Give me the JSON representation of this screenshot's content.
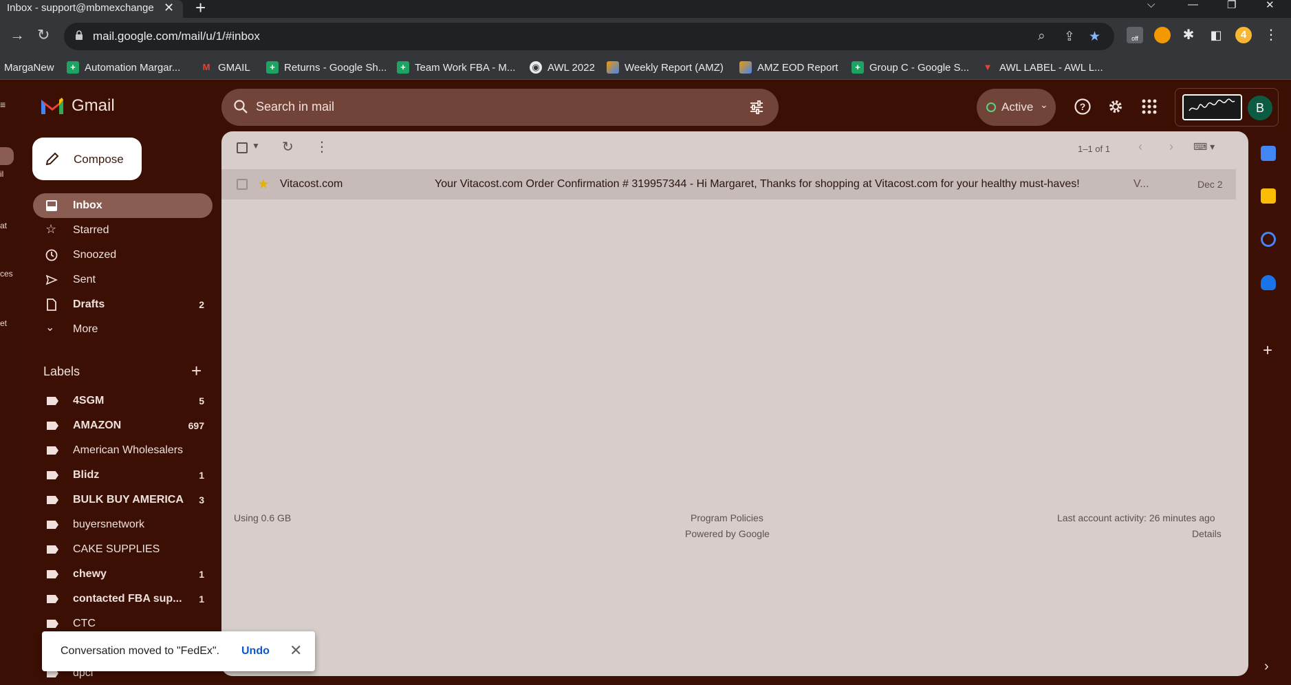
{
  "browser": {
    "tab_title": "Inbox - support@mbmexchange",
    "url": "mail.google.com/mail/u/1/#inbox",
    "extension_off_label": "off",
    "profile_badge": "4",
    "bookmarks": [
      {
        "label": "MargaNew",
        "icon": "none"
      },
      {
        "label": "Automation Margar...",
        "icon": "sheets-icon"
      },
      {
        "label": "GMAIL",
        "icon": "gmail-icon"
      },
      {
        "label": "Returns - Google Sh...",
        "icon": "sheets-icon"
      },
      {
        "label": "Team Work FBA - M...",
        "icon": "sheets-icon"
      },
      {
        "label": "AWL 2022",
        "icon": "globe-icon"
      },
      {
        "label": "Weekly Report (AMZ)",
        "icon": "report-icon"
      },
      {
        "label": "AMZ EOD Report",
        "icon": "report-icon"
      },
      {
        "label": "Group C - Google S...",
        "icon": "sheets-icon"
      },
      {
        "label": "AWL LABEL - AWL L...",
        "icon": "awl-icon"
      }
    ]
  },
  "gmail": {
    "brand": "Gmail",
    "search_placeholder": "Search in mail",
    "status_label": "Active",
    "avatar_initial": "B",
    "left_strip_labels": [
      "il",
      "at",
      "ces",
      "et"
    ],
    "compose_label": "Compose",
    "nav": [
      {
        "label": "Inbox",
        "count": "",
        "icon": "inbox-icon",
        "selected": true,
        "bold": true
      },
      {
        "label": "Starred",
        "count": "",
        "icon": "star-icon",
        "selected": false,
        "bold": false
      },
      {
        "label": "Snoozed",
        "count": "",
        "icon": "clock-icon",
        "selected": false,
        "bold": false
      },
      {
        "label": "Sent",
        "count": "",
        "icon": "send-icon",
        "selected": false,
        "bold": false
      },
      {
        "label": "Drafts",
        "count": "2",
        "icon": "draft-icon",
        "selected": false,
        "bold": true
      },
      {
        "label": "More",
        "count": "",
        "icon": "chevron-down-icon",
        "selected": false,
        "bold": false
      }
    ],
    "labels_heading": "Labels",
    "labels": [
      {
        "label": "4SGM",
        "count": "5",
        "bold": true
      },
      {
        "label": "AMAZON",
        "count": "697",
        "bold": true
      },
      {
        "label": "American Wholesalers",
        "count": "",
        "bold": false
      },
      {
        "label": "Blidz",
        "count": "1",
        "bold": true
      },
      {
        "label": "BULK BUY AMERICA",
        "count": "3",
        "bold": true
      },
      {
        "label": "buyersnetwork",
        "count": "",
        "bold": false
      },
      {
        "label": "CAKE SUPPLIES",
        "count": "",
        "bold": false
      },
      {
        "label": "chewy",
        "count": "1",
        "bold": true
      },
      {
        "label": "contacted FBA sup...",
        "count": "1",
        "bold": true
      },
      {
        "label": "CTC",
        "count": "",
        "bold": false
      },
      {
        "label": "dpci",
        "count": "",
        "bold": false
      }
    ],
    "pager_text": "1–1 of 1",
    "emails": [
      {
        "sender": "Vitacost.com",
        "subject": "Your Vitacost.com Order Confirmation # 319957344 - Hi Margaret, Thanks for shopping at Vitacost.com for your healthy must-haves!",
        "truncated": "V...",
        "date": "Dec 2",
        "starred": true
      }
    ],
    "footer": {
      "storage": "Using 0.6 GB",
      "policies": "Program Policies",
      "powered": "Powered by Google",
      "activity": "Last account activity: 26 minutes ago",
      "details": "Details"
    },
    "snackbar": {
      "message": "Conversation moved to \"FedEx\".",
      "undo": "Undo"
    }
  }
}
